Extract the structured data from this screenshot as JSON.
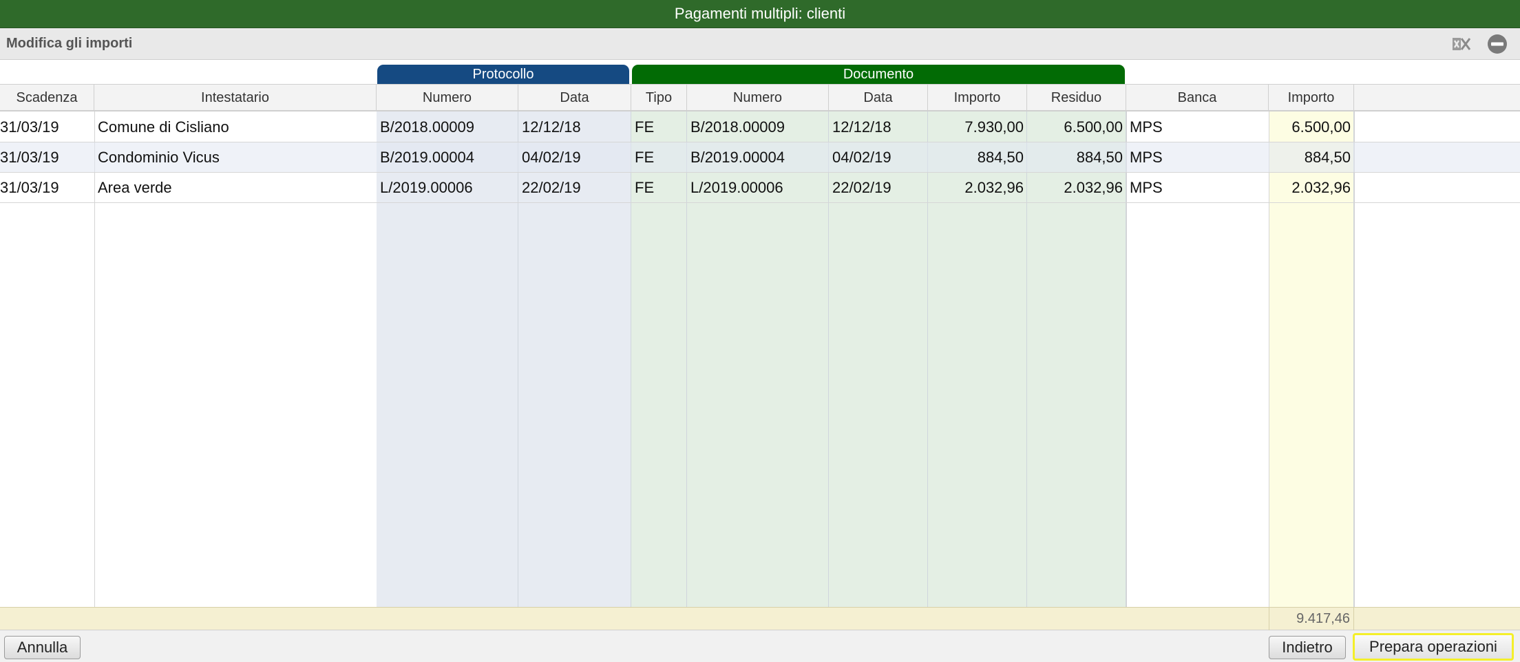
{
  "window": {
    "title": "Pagamenti multipli: clienti"
  },
  "subheader": {
    "title": "Modifica gli importi"
  },
  "icons": {
    "excel": "excel-export-icon",
    "minus": "minus-circle-icon"
  },
  "groups": {
    "protocollo": "Protocollo",
    "documento": "Documento"
  },
  "columns": [
    "Scadenza",
    "Intestatario",
    "Numero",
    "Data",
    "Tipo",
    "Numero",
    "Data",
    "Importo",
    "Residuo",
    "Banca",
    "Importo"
  ],
  "rows": [
    [
      "31/03/19",
      "Comune di Cisliano",
      "B/2018.00009",
      "12/12/18",
      "FE",
      "B/2018.00009",
      "12/12/18",
      "7.930,00",
      "6.500,00",
      "MPS",
      "6.500,00"
    ],
    [
      "31/03/19",
      "Condominio Vicus",
      "B/2019.00004",
      "04/02/19",
      "FE",
      "B/2019.00004",
      "04/02/19",
      "884,50",
      "884,50",
      "MPS",
      "884,50"
    ],
    [
      "31/03/19",
      "Area verde",
      "L/2019.00006",
      "22/02/19",
      "FE",
      "L/2019.00006",
      "22/02/19",
      "2.032,96",
      "2.032,96",
      "MPS",
      "2.032,96"
    ]
  ],
  "total": "9.417,46",
  "buttons": {
    "annulla": "Annulla",
    "indietro": "Indietro",
    "prepara": "Prepara operazioni"
  },
  "colors": {
    "title_bar": "#2f6a2a",
    "protocollo": "#154a82",
    "documento": "#026b05",
    "highlight": "#f4ef2a"
  }
}
